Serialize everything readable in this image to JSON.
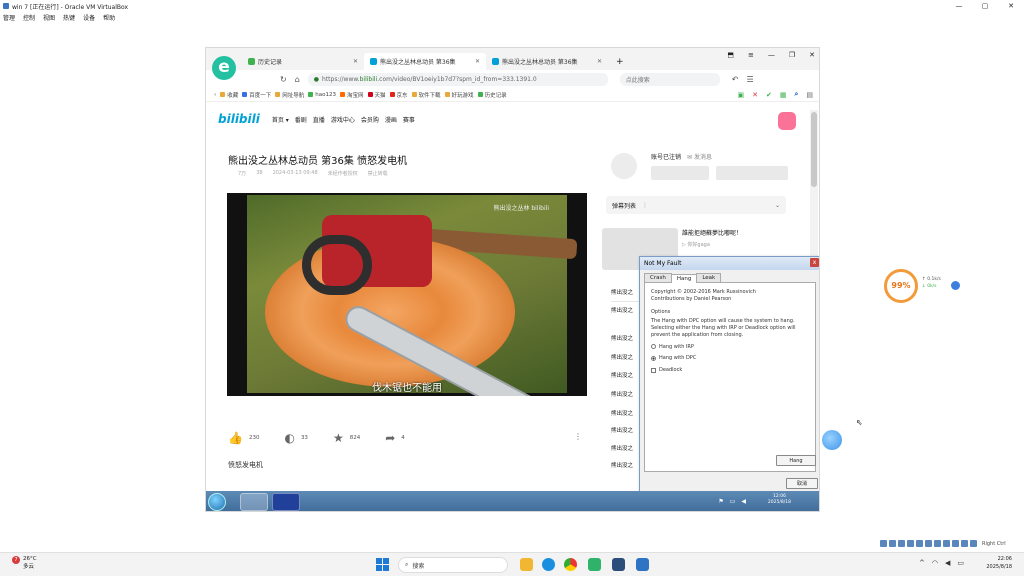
{
  "vbox": {
    "title": "win 7 [正在运行] - Oracle VM VirtualBox",
    "menu": [
      "管理",
      "控制",
      "视图",
      "热键",
      "设备",
      "帮助"
    ],
    "min": "—",
    "max": "▢",
    "close": "✕",
    "status_text": "Right Ctrl"
  },
  "browser": {
    "tabs": [
      {
        "label": "历史记录"
      },
      {
        "label": "熊出没之丛林总动员 第36集"
      },
      {
        "label": "熊出没之丛林总动员 第36集"
      }
    ],
    "new_tab": "+",
    "url_prefix": "https://www.",
    "url_domain": "bilibili",
    "url_rest": ".com/video/BV1oeiy1b7d7?spm_id_from=333.1391.0",
    "search_placeholder": "点此搜索",
    "bookmarks": [
      "收藏",
      "百度一下",
      "网址导航",
      "hao123",
      "淘宝网",
      "天猫",
      "京东",
      "软件下载",
      "好玩游戏",
      "历史记录"
    ]
  },
  "bili": {
    "logo": "bilibili",
    "nav": [
      "首页 ▾",
      "番剧",
      "直播",
      "游戏中心",
      "会员购",
      "漫画",
      "赛事"
    ],
    "video_title": "熊出没之丛林总动员 第36集 愤怒发电机",
    "meta": [
      "7万",
      "38",
      "2024-03-13 09:48",
      "未经作者授权",
      "禁止转载"
    ],
    "watermark": "熊出没之丛林 bilibili",
    "subtitle": "伐木锯也不能用",
    "actions": [
      {
        "icon": "👍",
        "count": "230"
      },
      {
        "icon": "◐",
        "count": "33"
      },
      {
        "icon": "★",
        "count": "824"
      },
      {
        "icon": "➦",
        "count": "4"
      }
    ],
    "more": "⋮",
    "tag": "愤怒发电机",
    "up_name": "账号已注销",
    "up_msg": "✉ 发消息",
    "danmu_label": "弹幕列表",
    "danmu_chevron": "⌄",
    "rec_title": "誰能拒絕蘇夢比嘟呢！",
    "rec_sub": "▷ 你好gaga",
    "side_items": [
      "熊出没之",
      "熊出没之",
      "熊出没之",
      "熊出没之",
      "熊出没之",
      "熊出没之",
      "熊出没之",
      "熊出没之",
      "熊出没之",
      "熊出没之"
    ]
  },
  "notmyfault": {
    "title": "Not My Fault",
    "close": "x",
    "tabs": [
      "Crash",
      "Hang",
      "Leak"
    ],
    "copyright": "Copyright © 2002-2016 Mark Russinovich",
    "contrib": "Contributions by Daniel Pearson",
    "options_label": "Options",
    "description": "The Hang with DPC option will cause the system to hang. Selecting either the Hang with IRP or Deadlock option will prevent the application from closing.",
    "opt1": "Hang with IRP",
    "opt2": "Hang with DPC",
    "opt3": "Deadlock",
    "hang_button": "Hang",
    "cancel_button": "取消"
  },
  "guest_taskbar": {
    "time": "12:06",
    "date": "2025/8/18"
  },
  "gauge": {
    "percent": "99%",
    "up": "↑ 0.1k/s",
    "down": "↓ 0k/s"
  },
  "host_taskbar": {
    "temp": "26°C",
    "weather": "多云",
    "badge": "7",
    "search": "搜索",
    "time": "22:06",
    "date": "2025/8/18"
  }
}
